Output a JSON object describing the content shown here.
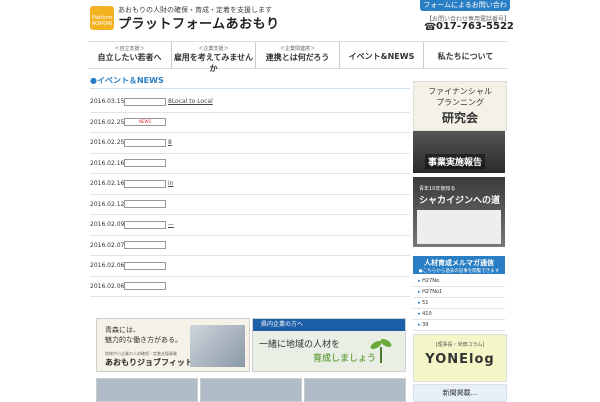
{
  "header": {
    "logo_text": "Platform AOMORI",
    "tagline": "あおもりの人財の確保・育成・定着を支援します",
    "site_name": "プラットフォームあおもり",
    "contact_button": "フォームによるお問い合わせ",
    "contact_note": "【お問い合わせ専用電話番号】",
    "phone": "017-763-5522"
  },
  "nav": [
    {
      "sub": "＜自立支援＞",
      "label": "自立したい若者へ"
    },
    {
      "sub": "＜企業支援＞",
      "label": "雇用を考えてみませんか"
    },
    {
      "sub": "＜企業間連携＞",
      "label": "連携とは何だろう"
    },
    {
      "sub": "",
      "label": "イベント&NEWS"
    },
    {
      "sub": "",
      "label": "私たちについて"
    }
  ],
  "news_section": {
    "title": "イベント＆NEWS"
  },
  "news": [
    {
      "date": "2016.03.15",
      "tag": "",
      "title": "8Local to Local"
    },
    {
      "date": "2016.02.25",
      "tag": "NEWS",
      "title": ""
    },
    {
      "date": "2016.02.25",
      "tag": "",
      "title": "8"
    },
    {
      "date": "2016.02.16",
      "tag": "",
      "title": ""
    },
    {
      "date": "2016.02.16",
      "tag": "",
      "title": "in"
    },
    {
      "date": "2016.02.12",
      "tag": "",
      "title": ""
    },
    {
      "date": "2016.02.09",
      "tag": "",
      "title": "—"
    },
    {
      "date": "2016.02.07",
      "tag": "",
      "title": ""
    },
    {
      "date": "2016.02.06",
      "tag": "",
      "title": ""
    },
    {
      "date": "2016.02.06",
      "tag": "",
      "title": ""
    }
  ],
  "banners": {
    "job": {
      "line1": "青森には、",
      "line2": "魅力的な働き方がある。",
      "sub": "地域中小企業の人材確保・定着支援事業",
      "name": "あおもりジョブフィット"
    },
    "company": {
      "head": "県内企業の方へ",
      "line1": "一緒に地域の人材を",
      "line2": "育成しましょう"
    }
  },
  "sidebar": {
    "fp": {
      "line1": "ファイナンシャル",
      "line2": "プランニング",
      "line3": "研究会"
    },
    "report": "事業実施報告",
    "shakai": {
      "small": "青年10年後知る",
      "large": "シャカイジンへの道"
    },
    "mailmag": {
      "title": "人材育成メルマガ通信",
      "sub": "●こちらから過去の記事を閲覧できます"
    },
    "mailmag_items": [
      "H27No.",
      "H27No1",
      "51",
      "410",
      "39"
    ],
    "yone": {
      "sub": "[理事長・米田コラム]",
      "title": "YONElog"
    },
    "last": "新聞掲載..."
  }
}
